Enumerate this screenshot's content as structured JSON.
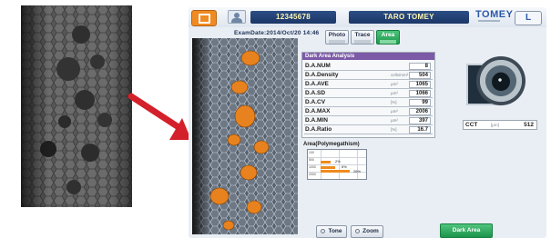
{
  "device": {
    "patient_id": "12345678",
    "patient_name": "TARO TOMEY",
    "brand": "TOMEY",
    "right_button_label": "L",
    "exam_date": "ExamDate:2014/Oct/20 14:46",
    "tabs": [
      {
        "label": "Photo",
        "active": false
      },
      {
        "label": "Trace",
        "active": false
      },
      {
        "label": "Area",
        "active": true
      }
    ],
    "analysis": {
      "title": "Dark Area Analysis",
      "rows": [
        {
          "label": "D.A.NUM",
          "unit": "",
          "value": "8"
        },
        {
          "label": "D.A.Density",
          "unit": "cells/mm²",
          "value": "504"
        },
        {
          "label": "D.A.AVE",
          "unit": "μm²",
          "value": "1065"
        },
        {
          "label": "D.A.SD",
          "unit": "μm²",
          "value": "1066"
        },
        {
          "label": "D.A.CV",
          "unit": "[%]",
          "value": "99"
        },
        {
          "label": "D.A.MAX",
          "unit": "μm²",
          "value": "2006"
        },
        {
          "label": "D.A.MIN",
          "unit": "μm²",
          "value": "397"
        },
        {
          "label": "D.A.Ratio",
          "unit": "[%]",
          "value": "16.7"
        }
      ]
    },
    "cct": {
      "label": "CCT",
      "unit": "[μm]",
      "value": "512"
    },
    "histogram": {
      "title": "Area(Polymegathism)",
      "bars": [
        {
          "fraction": 0.22,
          "label": "2%"
        },
        {
          "fraction": 0.32,
          "label": "6%"
        },
        {
          "fraction": 0.64,
          "label": "26%"
        }
      ]
    },
    "buttons": {
      "tone": "Tone",
      "zoom": "Zoom",
      "green": "Dark Area"
    },
    "colors": {
      "accent_orange": "#f08a22",
      "tab_active_green": "#1f9a4e",
      "panel_header_purple": "#7c5aa7",
      "arrow_red": "#d4202a",
      "dark_area_orange": "#e8821e"
    }
  }
}
